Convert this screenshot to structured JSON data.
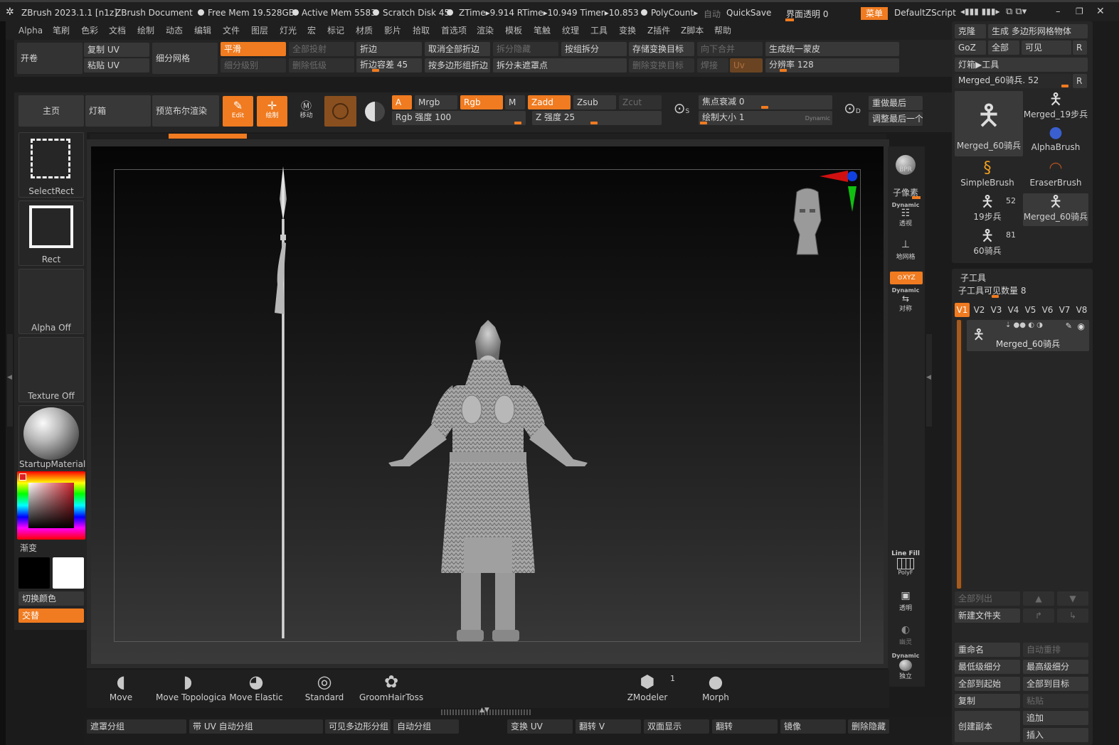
{
  "titlebar": {
    "app": "ZBrush 2023.1.1 [n1z]",
    "doc": "ZBrush Document",
    "free_mem": "Free Mem 19.528GB",
    "active_mem": "Active Mem 5583",
    "scratch": "Scratch Disk 45",
    "ztime": "ZTime▸9.914 RTime▸10.949 Timer▸10.853",
    "polycount": "PolyCount▸",
    "auto": "自动",
    "quicksave": "QuickSave",
    "transparency": "界面透明 0",
    "menu": "菜单",
    "zscript": "DefaultZScript"
  },
  "menubar": [
    "Alpha",
    "笔刷",
    "色彩",
    "文档",
    "绘制",
    "动态",
    "编辑",
    "文件",
    "图层",
    "灯光",
    "宏",
    "标记",
    "材质",
    "影片",
    "拾取",
    "首选项",
    "渲染",
    "模板",
    "笔触",
    "纹理",
    "工具",
    "变换",
    "Z插件",
    "Z脚本",
    "帮助"
  ],
  "shelf1": {
    "open": "开卷",
    "copy_uv": "复制 UV",
    "paste_uv": "粘贴 UV",
    "subdiv_mesh": "细分网格",
    "smooth": "平滑",
    "subdiv_level": "细分级别",
    "all_proj": "全部投射",
    "del_lower": "删除低级",
    "crease": "折边",
    "crease_tol": "折边容差 45",
    "uncrease_all": "取消全部折边",
    "crease_pg": "按多边形组折边",
    "split_hidden": "拆分隐藏",
    "split_unmasked": "拆分未遮罩点",
    "split_groups": "按组拆分",
    "store_morph": "存储变换目标",
    "del_morph": "删除变换目标",
    "merge_down": "向下合并",
    "weld": "焊接",
    "uv": "Uv",
    "unified_skin": "生成统一蒙皮",
    "resolution": "分辨率 128"
  },
  "shelf2": {
    "home": "主页",
    "lightbox": "灯箱",
    "bool_preview": "预览布尔渲染",
    "edit": "Edit",
    "draw": "绘制",
    "move": "移动",
    "a": "A",
    "mrgb": "Mrgb",
    "rgb": "Rgb",
    "m": "M",
    "zadd": "Zadd",
    "zsub": "Zsub",
    "zcut": "Zcut",
    "rgb_intensity": "Rgb 强度 100",
    "z_intensity": "Z 强度 25",
    "focal": "焦点衰减 0",
    "draw_size": "绘制大小 1",
    "dynamic": "Dynamic",
    "redo_last": "重做最后",
    "adjust_last": "调整最后一个"
  },
  "left": {
    "selectrect": "SelectRect",
    "rect": "Rect",
    "alpha_off": "Alpha Off",
    "texture_off": "Texture Off",
    "material": "StartupMaterial",
    "gradient": "渐变",
    "switch_color": "切换颜色",
    "alternate": "交替"
  },
  "rightbar": {
    "bpr": "BPR",
    "subpixel": "子像素",
    "dynamic": "Dynamic",
    "persp": "透视",
    "floor": "地网格",
    "xyz": "XYZ",
    "sym": "对称",
    "linefill": "Line Fill",
    "polyf": "PolyF",
    "transp": "透明",
    "ghost": "幽灵",
    "solo": "独立"
  },
  "brushes": [
    {
      "name": "Move"
    },
    {
      "name": "Move Topologica"
    },
    {
      "name": "Move Elastic"
    },
    {
      "name": "Standard"
    },
    {
      "name": "GroomHairToss"
    },
    {
      "name": "ZModeler",
      "count": "1"
    },
    {
      "name": "Morph"
    }
  ],
  "bottombar": [
    "遮罩分组",
    "带 UV 自动分组",
    "可见多边形分组",
    "自动分组",
    "变换 UV",
    "翻转 V",
    "双面显示",
    "翻转",
    "镜像",
    "删除隐藏"
  ],
  "tool": {
    "clone": "克隆",
    "make_polymesh": "生成 多边形网格物体",
    "goz": "GoZ",
    "all": "全部",
    "visible": "可见",
    "r": "R",
    "lightbox_tool": "灯箱▶工具",
    "current": "Merged_60骑兵. 52",
    "items": [
      {
        "name": "Merged_60骑兵"
      },
      {
        "name": "Merged_19步兵"
      },
      {
        "name": "AlphaBrush"
      },
      {
        "name": "SimpleBrush"
      },
      {
        "name": "EraserBrush"
      },
      {
        "name": "19步兵",
        "count": "52"
      },
      {
        "name": "Merged_60骑兵"
      },
      {
        "name": "60骑兵",
        "count": "81"
      }
    ]
  },
  "subtool": {
    "title": "子工具",
    "visible_count": "子工具可见数量 8",
    "versions": [
      "V1",
      "V2",
      "V3",
      "V4",
      "V5",
      "V6",
      "V7",
      "V8"
    ],
    "item": "Merged_60骑兵",
    "list_all": "全部列出",
    "new_folder": "新建文件夹",
    "rename": "重命名",
    "auto_reorder": "自动重排",
    "lowest_subdiv": "最低级细分",
    "highest_subdiv": "最高级细分",
    "all_to_start": "全部到起始",
    "all_to_target": "全部到目标",
    "copy": "复制",
    "paste": "粘贴",
    "append": "追加",
    "duplicate": "创建副本",
    "insert": "插入"
  },
  "colors": {
    "accent": "#f07b20",
    "bg": "#1b1b1b",
    "panel": "#2d2d2d"
  }
}
